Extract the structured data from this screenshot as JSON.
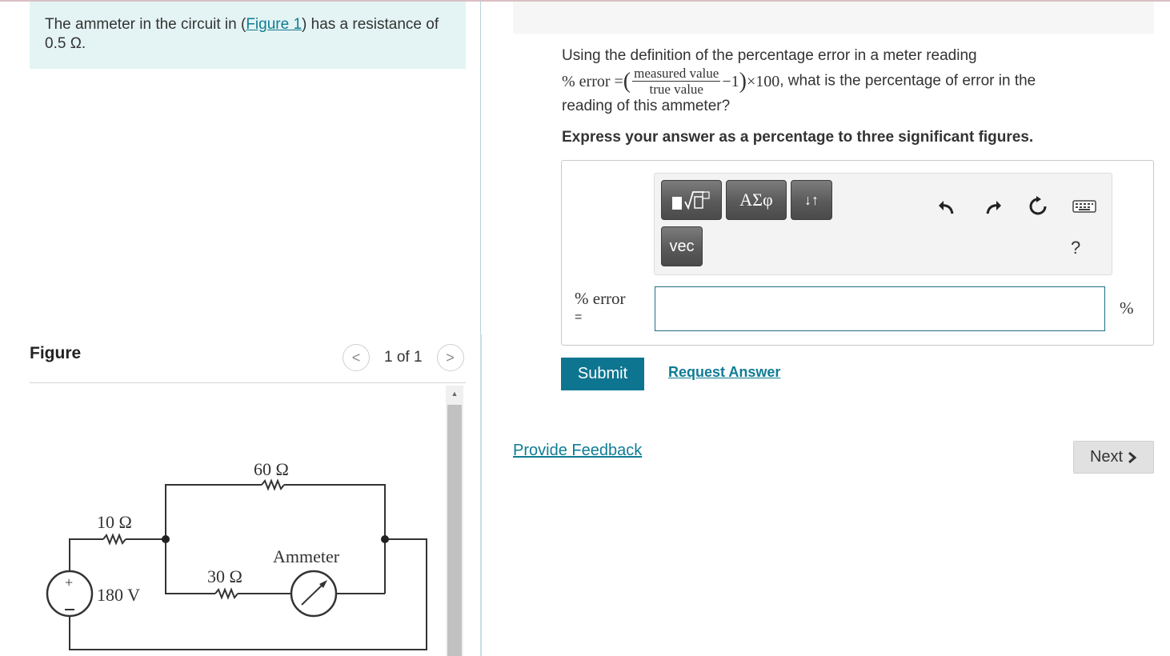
{
  "problem": {
    "text_before": "The ammeter in the circuit in (",
    "figure_link": "Figure 1",
    "text_after": ") has a resistance of 0.5 Ω."
  },
  "figure": {
    "header": "Figure",
    "counter": "1 of 1",
    "prev_glyph": "<",
    "next_glyph": ">",
    "scroll_up_glyph": "▲",
    "circuit": {
      "r_top": "60 Ω",
      "r_left": "10 Ω",
      "r_middle": "30 Ω",
      "meter_label": "Ammeter",
      "source": "180 V",
      "source_plus": "+"
    }
  },
  "question": {
    "line1": "Using the definition of the percentage error in a meter reading",
    "formula_lhs": "% error =",
    "formula_numerator": "measured value",
    "formula_denominator": "true value",
    "formula_rhs": "−1",
    "formula_times": "×100",
    "line2_tail": ", what is the percentage of error in the",
    "line3": "reading of this ammeter?",
    "instruction": "Express your answer as a percentage to three significant figures."
  },
  "toolbar": {
    "greek_label": "ΑΣφ",
    "arrows_label": "↓↑",
    "vec_label": "vec",
    "help_label": "?",
    "icons": [
      "templates-icon",
      "greek-letters-icon",
      "subscript-superscript-icon",
      "vector-icon",
      "undo-icon",
      "redo-icon",
      "reset-icon",
      "keyboard-icon",
      "help-icon"
    ]
  },
  "answer": {
    "label_line1": "% error",
    "label_line2": "=",
    "value": "",
    "unit": "%"
  },
  "actions": {
    "submit": "Submit",
    "request_answer": "Request Answer",
    "provide_feedback": "Provide Feedback",
    "next": "Next"
  },
  "colors": {
    "accent": "#0e7590",
    "link": "#0f7c94",
    "problem_bg": "#e4f4f4"
  }
}
